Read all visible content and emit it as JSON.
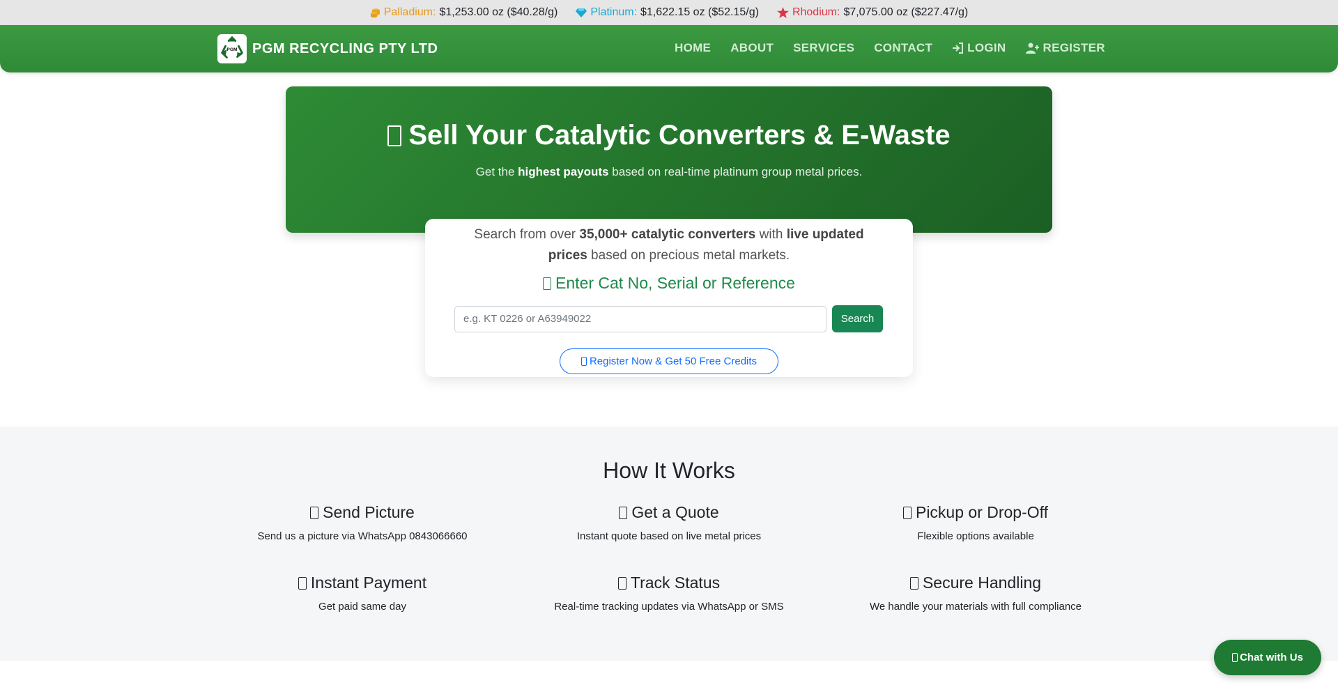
{
  "ticker": [
    {
      "name": "Palladium:",
      "value": "$1,253.00 oz ($40.28/g)",
      "color": "#e69a1c",
      "icon": "coins-icon"
    },
    {
      "name": "Platinum:",
      "value": "$1,622.15 oz ($52.15/g)",
      "color": "#1aa9d3",
      "icon": "gem-icon"
    },
    {
      "name": "Rhodium:",
      "value": "$7,075.00 oz ($227.47/g)",
      "color": "#dc3545",
      "icon": "star-icon"
    }
  ],
  "brand": {
    "logo_text": "PGM",
    "name": "PGM RECYCLING PTY LTD"
  },
  "nav": {
    "home": "HOME",
    "about": "ABOUT",
    "services": "SERVICES",
    "contact": "CONTACT",
    "login": "LOGIN",
    "register": "REGISTER"
  },
  "hero": {
    "title": "Sell Your Catalytic Converters & E-Waste",
    "sub_pre": "Get the ",
    "sub_bold": "highest payouts",
    "sub_post": " based on real-time platinum group metal prices."
  },
  "search": {
    "intro_1": "Search from over ",
    "intro_bold_1": "35,000+ catalytic converters",
    "intro_2": " with ",
    "intro_bold_2": "live updated prices",
    "intro_3": " based on precious metal markets.",
    "heading": "Enter Cat No, Serial or Reference",
    "placeholder": "e.g. KT 0226 or A63949022",
    "button": "Search",
    "register_cta": "Register Now & Get 50 Free Credits"
  },
  "how": {
    "title": "How It Works",
    "steps": [
      {
        "title": "Send Picture",
        "desc": "Send us a picture via WhatsApp 0843066660"
      },
      {
        "title": "Get a Quote",
        "desc": "Instant quote based on live metal prices"
      },
      {
        "title": "Pickup or Drop-Off",
        "desc": "Flexible options available"
      },
      {
        "title": "Instant Payment",
        "desc": "Get paid same day"
      },
      {
        "title": "Track Status",
        "desc": "Real-time tracking updates via WhatsApp or SMS"
      },
      {
        "title": "Secure Handling",
        "desc": "We handle your materials with full compliance"
      }
    ]
  },
  "chat": {
    "label": "Chat with Us"
  },
  "colors": {
    "nav_green": "#2f8a37",
    "hero_green": "#1b5f24",
    "accent_green": "#198754",
    "link_blue": "#0d6efd"
  }
}
